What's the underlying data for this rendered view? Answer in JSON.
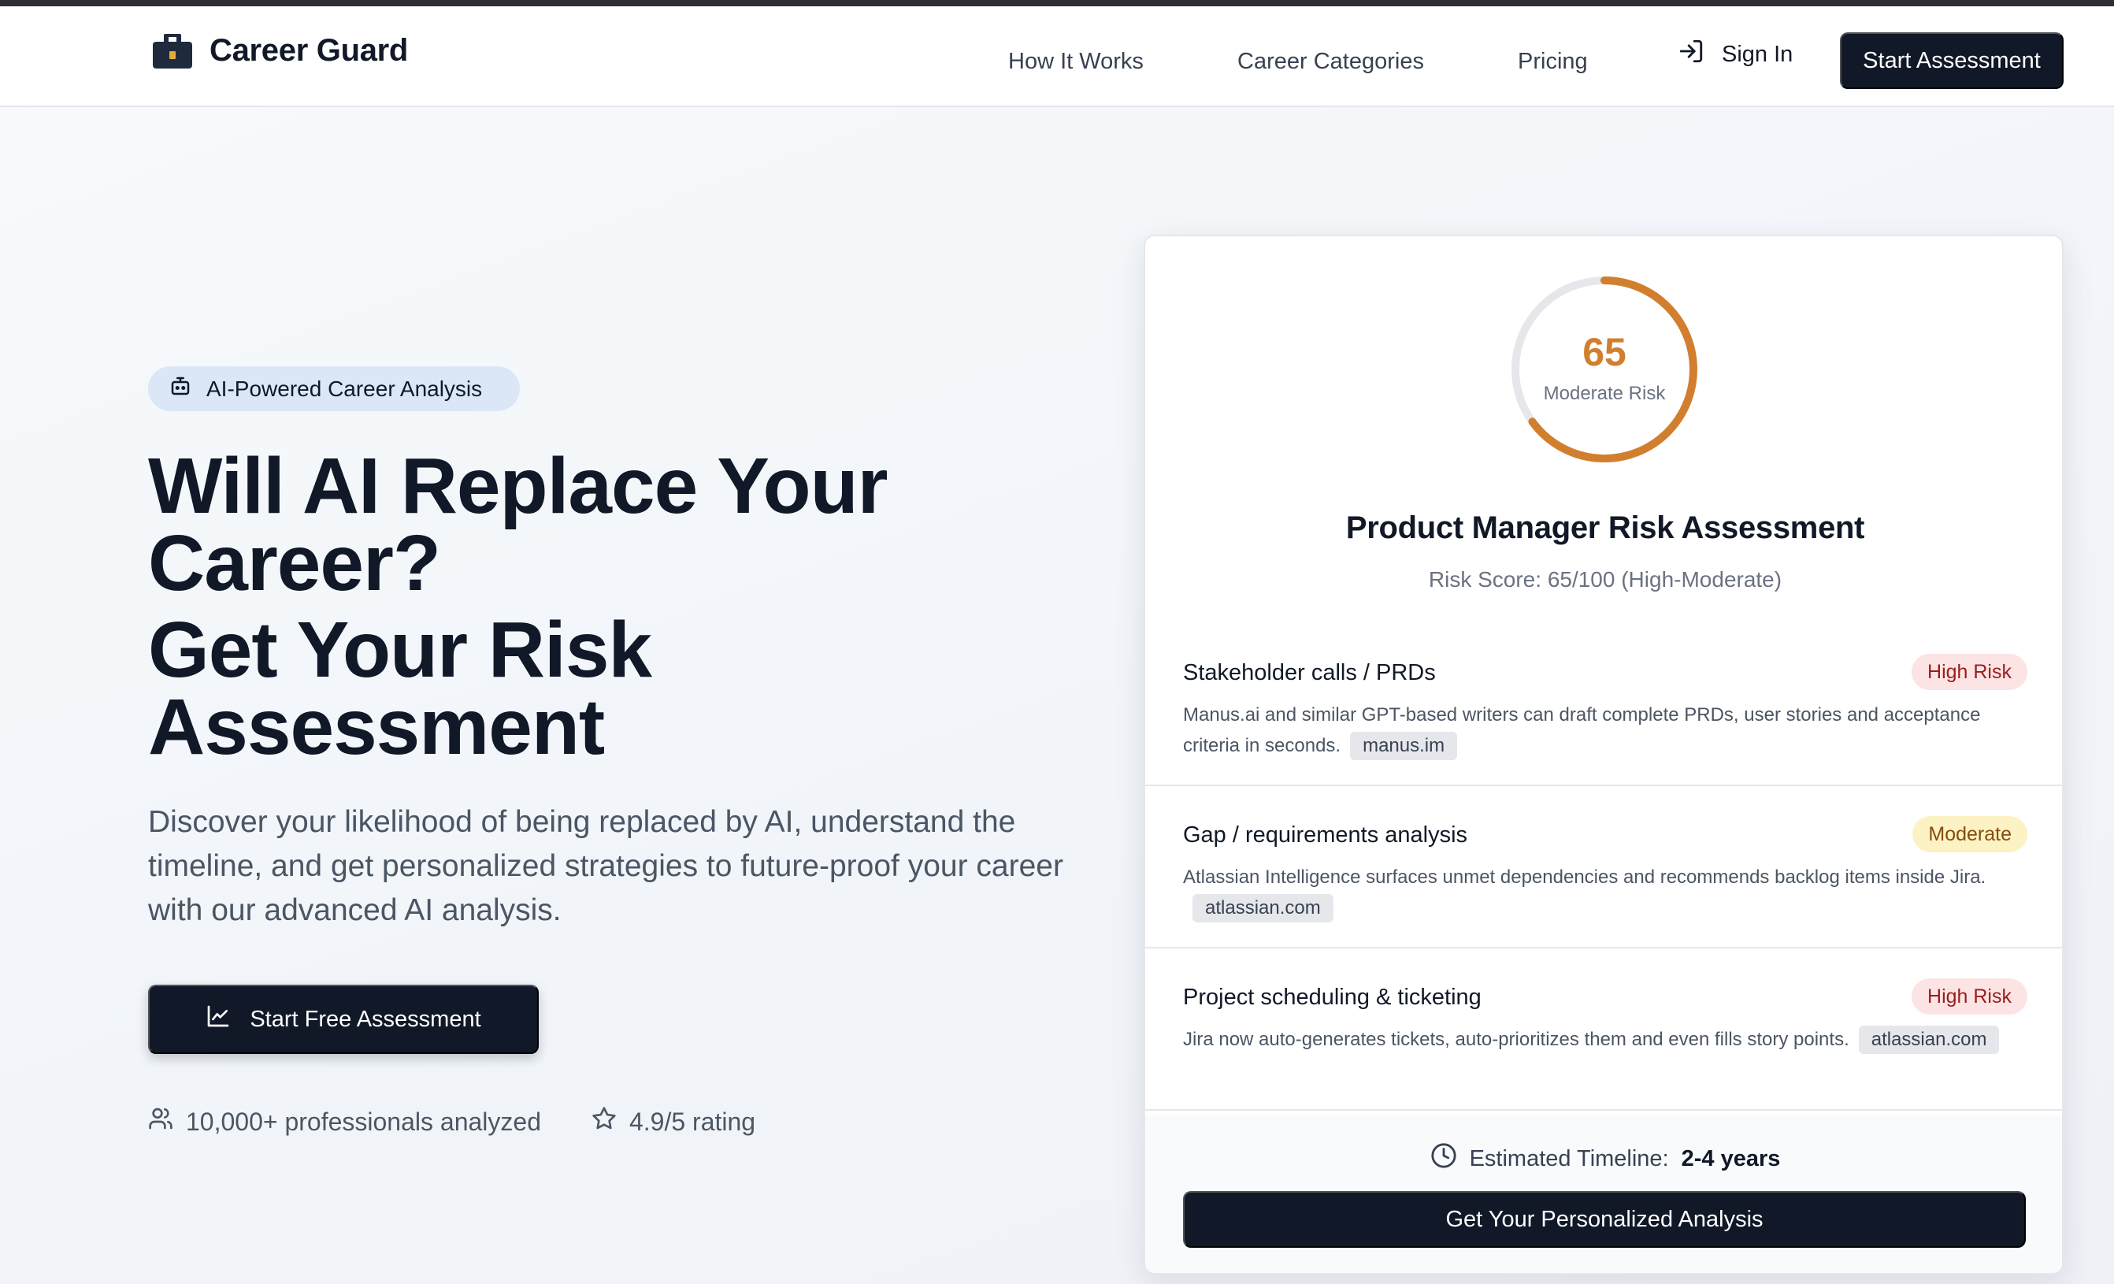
{
  "brand": {
    "name": "Career Guard"
  },
  "nav": {
    "links": [
      "How It Works",
      "Career Categories",
      "Pricing"
    ],
    "sign_in": "Sign In",
    "start_assessment": "Start Assessment"
  },
  "hero": {
    "badge": "AI-Powered Career Analysis",
    "headline": "Will AI Replace Your Career?",
    "subheadline": "Get Your Risk Assessment",
    "description": "Discover your likelihood of being replaced by AI, understand the timeline, and get personalized strategies to future-proof your career with our advanced AI analysis.",
    "cta": "Start Free Assessment",
    "stats": [
      {
        "icon": "users-icon",
        "text": "10,000+ professionals analyzed"
      },
      {
        "icon": "star-icon",
        "text": "4.9/5 rating"
      }
    ]
  },
  "card": {
    "score": "65",
    "score_value": 65,
    "score_max": 100,
    "score_label": "Moderate Risk",
    "title": "Product Manager Risk Assessment",
    "subtitle": "Risk Score: 65/100 (High-Moderate)",
    "items": [
      {
        "name": "Stakeholder calls / PRDs",
        "badge": "High Risk",
        "text": "Manus.ai and similar GPT-based writers can draft complete PRDs, user stories and acceptance criteria in seconds.",
        "source": "manus.im"
      },
      {
        "name": "Gap / requirements analysis",
        "badge": "Moderate",
        "text": "Atlassian Intelligence surfaces unmet dependencies and recommends backlog items inside Jira.",
        "source": "atlassian.com"
      },
      {
        "name": "Project scheduling & ticketing",
        "badge": "High Risk",
        "text": "Jira now auto-generates tickets, auto-prioritizes them and even fills story points.",
        "source": "atlassian.com"
      }
    ],
    "timeline_label": "Estimated Timeline:",
    "timeline_value": "2-4 years",
    "button": "Get Your Personalized Analysis"
  },
  "colors": {
    "accent_orange": "#d17f2e",
    "dark": "#111827",
    "high_risk_bg": "#fde4e4",
    "high_risk_text": "#9b1c1c",
    "moderate_bg": "#fdf2c4",
    "moderate_text": "#854d0e"
  }
}
